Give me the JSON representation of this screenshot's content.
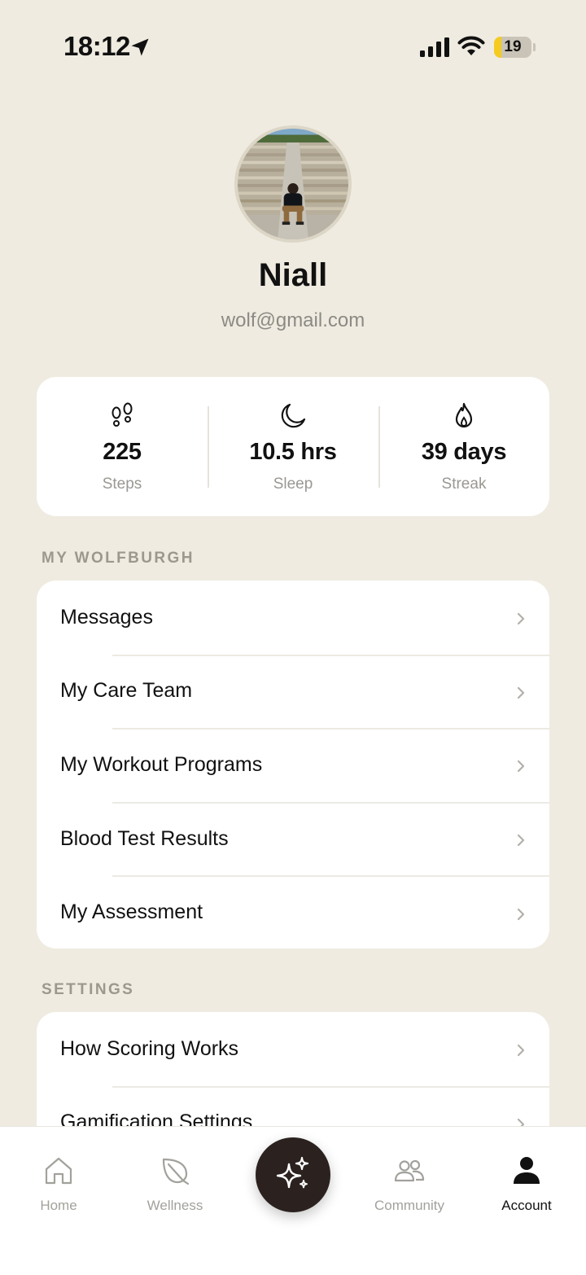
{
  "status_bar": {
    "time": "18:12",
    "battery_level": "19",
    "battery_fraction": 0.19,
    "battery_color": "#F5CB20"
  },
  "profile": {
    "name": "Niall",
    "email": "wolf@gmail.com"
  },
  "stats": [
    {
      "icon": "footprints-icon",
      "value": "225",
      "label": "Steps"
    },
    {
      "icon": "moon-icon",
      "value": "10.5 hrs",
      "label": "Sleep"
    },
    {
      "icon": "flame-icon",
      "value": "39 days",
      "label": "Streak"
    }
  ],
  "my_wolfburgh": {
    "header": "MY WOLFBURGH",
    "items": [
      {
        "label": "Messages"
      },
      {
        "label": "My Care Team"
      },
      {
        "label": "My Workout Programs"
      },
      {
        "label": "Blood Test Results"
      },
      {
        "label": "My Assessment"
      }
    ]
  },
  "settings": {
    "header": "SETTINGS",
    "items": [
      {
        "label": "How Scoring Works"
      },
      {
        "label": "Gamification Settings"
      }
    ]
  },
  "tab_bar": {
    "tabs": [
      {
        "label": "Home",
        "icon": "home-icon"
      },
      {
        "label": "Wellness",
        "icon": "leaf-icon"
      },
      {
        "label": "Community",
        "icon": "community-icon"
      },
      {
        "label": "Account",
        "icon": "account-icon",
        "active": true
      }
    ],
    "center_action_icon": "sparkles-icon"
  },
  "colors": {
    "background": "#EFEBE0",
    "card": "#FFFFFF",
    "accent_dark": "#2B2220",
    "muted_text": "#9A9893"
  }
}
